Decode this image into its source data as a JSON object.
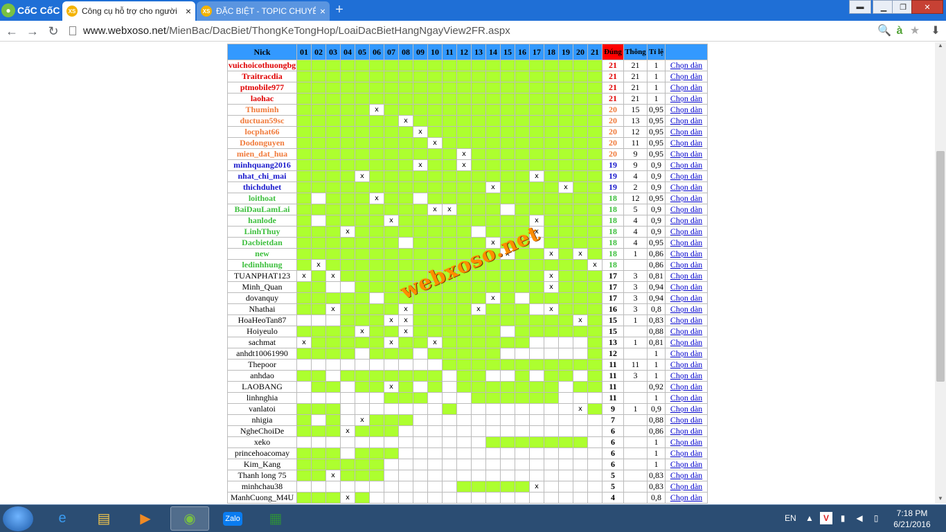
{
  "browser": {
    "brand": "CốC CốC",
    "tabs": [
      {
        "favicon": "XS",
        "label": "Công cụ hỗ trợ cho người",
        "close": "×"
      },
      {
        "favicon": "XS",
        "label": "ĐẶC BIỆT - TOPIC CHUYÊN",
        "close": "×"
      }
    ],
    "new_tab": "+",
    "window_controls": {
      "menu": "▬",
      "minimize": "▁",
      "maximize": "❐",
      "close": "✕"
    },
    "nav": {
      "back": "←",
      "forward": "→",
      "reload": "↻"
    },
    "url_host": "www.webxoso.net",
    "url_path": "/MienBac/DacBiet/ThongKeTongHop/LoaiDacBietHangNgayView2FR.aspx",
    "toolbar_icons": {
      "zoom": "🔍",
      "assistant": "à",
      "bookmark": "★",
      "download": "⬇"
    }
  },
  "table": {
    "headers": {
      "nick": "Nick",
      "days": [
        "01",
        "02",
        "03",
        "04",
        "05",
        "06",
        "07",
        "08",
        "09",
        "10",
        "11",
        "12",
        "13",
        "14",
        "15",
        "16",
        "17",
        "18",
        "19",
        "20",
        "21"
      ],
      "dung": "Đúng",
      "thong": "Thông",
      "tile": "Tỉ lệ",
      "chon": ""
    },
    "rows": [
      {
        "nick": "vuichoicothuongbg",
        "color": "red",
        "cells": "GGGGGGGGGGGGGGGGGGGGG",
        "dung": "21",
        "thong": "21",
        "tile": "1",
        "chon": "Chọn dàn"
      },
      {
        "nick": "Traitracdia",
        "color": "red",
        "cells": "GGGGGGGGGGGGGGGGGGGGG",
        "dung": "21",
        "thong": "21",
        "tile": "1",
        "chon": "Chọn dàn"
      },
      {
        "nick": "ptmobile977",
        "color": "red",
        "cells": "GGGGGGGGGGGGGGGGGGGGG",
        "dung": "21",
        "thong": "21",
        "tile": "1",
        "chon": "Chọn dàn"
      },
      {
        "nick": "laohac",
        "color": "red",
        "cells": "GGGGGGGGGGGGGGGGGGGGG",
        "dung": "21",
        "thong": "21",
        "tile": "1",
        "chon": "Chọn dàn"
      },
      {
        "nick": "Thuminh",
        "color": "orange",
        "cells": "GGGGGXGGGGGGGGGGGGGGG",
        "dung": "20",
        "thong": "15",
        "tile": "0,95",
        "chon": "Chọn dàn"
      },
      {
        "nick": "ductuan59sc",
        "color": "orange",
        "cells": "GGGGGGGXGGGGGGGGGGGGG",
        "dung": "20",
        "thong": "13",
        "tile": "0,95",
        "chon": "Chọn dàn"
      },
      {
        "nick": "locphat66",
        "color": "orange",
        "cells": "GGGGGGGGXGGGGGGGGGGGG",
        "dung": "20",
        "thong": "12",
        "tile": "0,95",
        "chon": "Chọn dàn"
      },
      {
        "nick": "Dodonguyen",
        "color": "orange",
        "cells": "GGGGGGGGGXGGGGGGGGGGG",
        "dung": "20",
        "thong": "11",
        "tile": "0,95",
        "chon": "Chọn dàn"
      },
      {
        "nick": "mien_dat_hua",
        "color": "orange",
        "cells": "GGGGGGGGGGGXGGGGGGGGG",
        "dung": "20",
        "thong": "9",
        "tile": "0,95",
        "chon": "Chọn dàn"
      },
      {
        "nick": "minhquang2016",
        "color": "blue",
        "cells": "GGGGGGGGXGGXGGGGGGGGG",
        "dung": "19",
        "thong": "9",
        "tile": "0,9",
        "chon": "Chọn dàn"
      },
      {
        "nick": "nhat_chi_mai",
        "color": "blue",
        "cells": "GGGGXGGGGGGGGGGGXGGGG",
        "dung": "19",
        "thong": "4",
        "tile": "0,9",
        "chon": "Chọn dàn"
      },
      {
        "nick": "thichduhet",
        "color": "blue",
        "cells": "GGGGGGGGGGGGGXGGGGXGG",
        "dung": "19",
        "thong": "2",
        "tile": "0,9",
        "chon": "Chọn dàn"
      },
      {
        "nick": "loithoat",
        "color": "green",
        "cells": "GWGGGXGGWGGGGGGGGGGGG",
        "dung": "18",
        "thong": "12",
        "tile": "0,95",
        "chon": "Chọn dàn"
      },
      {
        "nick": "BaiDauLamLai",
        "color": "green",
        "cells": "GGGGGGGGGXXGGGWGGGGGG",
        "dung": "18",
        "thong": "5",
        "tile": "0,9",
        "chon": "Chọn dàn"
      },
      {
        "nick": "hanlode",
        "color": "green",
        "cells": "GWGGGGXGGGGGGGGGXGGGG",
        "dung": "18",
        "thong": "4",
        "tile": "0,9",
        "chon": "Chọn dàn"
      },
      {
        "nick": "LinhThuy",
        "color": "green",
        "cells": "GGGXGGGGGGGGWGGGXGGGG",
        "dung": "18",
        "thong": "4",
        "tile": "0,9",
        "chon": "Chọn dàn"
      },
      {
        "nick": "Dacbietdan",
        "color": "green",
        "cells": "GGGGGGGWGGGGGXGGWGGGG",
        "dung": "18",
        "thong": "4",
        "tile": "0,95",
        "chon": "Chọn dàn"
      },
      {
        "nick": "new",
        "color": "green",
        "cells": "GGGGGGGGGGGGGGXGGXGXG",
        "dung": "18",
        "thong": "1",
        "tile": "0,86",
        "chon": "Chọn dàn"
      },
      {
        "nick": "ledinhhung",
        "color": "green",
        "cells": "GXGGGGGGGGGGGGGGGGGGX",
        "dung": "18",
        "thong": "",
        "tile": "0,86",
        "chon": "Chọn dàn"
      },
      {
        "nick": "TUANPHAT123",
        "color": "plain",
        "cells": "XGXGGGGGGGGGGGGGGXGGG",
        "dung": "17",
        "thong": "3",
        "tile": "0,81",
        "chon": "Chọn dàn"
      },
      {
        "nick": "Minh_Quan",
        "color": "plain",
        "cells": "GGWWGGGGGGGGGGGGGXGGG",
        "dung": "17",
        "thong": "3",
        "tile": "0,94",
        "chon": "Chọn dàn"
      },
      {
        "nick": "dovanquy",
        "color": "plain",
        "cells": "GGGGGWGGGGGGGXGWGGGGG",
        "dung": "17",
        "thong": "3",
        "tile": "0,94",
        "chon": "Chọn dàn"
      },
      {
        "nick": "Nhathai",
        "color": "plain",
        "cells": "GGXGGGGXGGGGXGGGWXGGG",
        "dung": "16",
        "thong": "3",
        "tile": "0,8",
        "chon": "Chọn dàn"
      },
      {
        "nick": "HoaHeoTan87",
        "color": "plain",
        "cells": "WWWGGGXXGGGGGGGGGGGXG",
        "dung": "15",
        "thong": "1",
        "tile": "0,83",
        "chon": "Chọn dàn"
      },
      {
        "nick": "Hoiyeulo",
        "color": "plain",
        "cells": "GGGGXGGXGGGGGGWGGGGGG",
        "dung": "15",
        "thong": "",
        "tile": "0,88",
        "chon": "Chọn dàn"
      },
      {
        "nick": "sachmat",
        "color": "plain",
        "cells": "XGGGGGXGGXGGGGGGWWWWG",
        "dung": "13",
        "thong": "1",
        "tile": "0,81",
        "chon": "Chọn dàn"
      },
      {
        "nick": "anhdt10061990",
        "color": "plain",
        "cells": "GGGGWGGGWGGGGGWWWWWWG",
        "dung": "12",
        "thong": "",
        "tile": "1",
        "chon": "Chọn dàn"
      },
      {
        "nick": "Thepoor",
        "color": "plain",
        "cells": "WWWWWWWWWWGGGGGGGGGGG",
        "dung": "11",
        "thong": "11",
        "tile": "1",
        "chon": "Chọn dàn"
      },
      {
        "nick": "anhdao",
        "color": "plain",
        "cells": "GGWGGGGGGGWGGWWGWGGWG",
        "dung": "11",
        "thong": "3",
        "tile": "1",
        "chon": "Chọn dàn"
      },
      {
        "nick": "LAOBANG",
        "color": "plain",
        "cells": "WGGWGGXGWGWGGGGGGGWGG",
        "dung": "11",
        "thong": "",
        "tile": "0,92",
        "chon": "Chọn dàn"
      },
      {
        "nick": "linhnghia",
        "color": "plain",
        "cells": "WWWWWWGGGWWWGGGGGGWWW",
        "dung": "11",
        "thong": "",
        "tile": "1",
        "chon": "Chọn dàn"
      },
      {
        "nick": "vanlatoi",
        "color": "plain",
        "cells": "GGGWWWWWWWGWWWWWWWWXG",
        "dung": "9",
        "thong": "1",
        "tile": "0,9",
        "chon": "Chọn dàn"
      },
      {
        "nick": "nhigia",
        "color": "plain",
        "cells": "GWGWXGGGWWWWWWWWWWWWW",
        "dung": "7",
        "thong": "",
        "tile": "0,88",
        "chon": "Chọn dàn"
      },
      {
        "nick": "NgheChoiDe",
        "color": "plain",
        "cells": "GGGXGGGWWWWWWWWWWWWWW",
        "dung": "6",
        "thong": "",
        "tile": "0,86",
        "chon": "Chọn dàn"
      },
      {
        "nick": "xeko",
        "color": "plain",
        "cells": "WWWWWWWWWWWWWGGGGGGGW",
        "dung": "6",
        "thong": "",
        "tile": "1",
        "chon": "Chọn dàn"
      },
      {
        "nick": "princehoacomay",
        "color": "plain",
        "cells": "GGGWGGGWWWWWWWWWWWWWW",
        "dung": "6",
        "thong": "",
        "tile": "1",
        "chon": "Chọn dàn"
      },
      {
        "nick": "Kim_Kang",
        "color": "plain",
        "cells": "GGGGGGWWWWWWWWWWWWWWW",
        "dung": "6",
        "thong": "",
        "tile": "1",
        "chon": "Chọn dàn"
      },
      {
        "nick": "Thanh long 75",
        "color": "plain",
        "cells": "GGXGGGWWWWWWWWWWWWWWW",
        "dung": "5",
        "thong": "",
        "tile": "0,83",
        "chon": "Chọn dàn"
      },
      {
        "nick": "minhchau38",
        "color": "plain",
        "cells": "WWWWWWWWWWWGGGGGXWWWW",
        "dung": "5",
        "thong": "",
        "tile": "0,83",
        "chon": "Chọn dàn"
      },
      {
        "nick": "ManhCuong_M4U",
        "color": "plain",
        "cells": "GGGXGWWWWWWWWWWWWWWWW",
        "dung": "4",
        "thong": "",
        "tile": "0,8",
        "chon": "Chọn dàn"
      }
    ],
    "mark": "x"
  },
  "watermark": "webxoso.net",
  "taskbar": {
    "apps": [
      "internet-explorer",
      "file-explorer",
      "media-player",
      "coccoc",
      "zalo",
      "excel"
    ],
    "zalo_label": "Zalo",
    "lang": "EN",
    "time": "7:18 PM",
    "date": "6/21/2016"
  }
}
